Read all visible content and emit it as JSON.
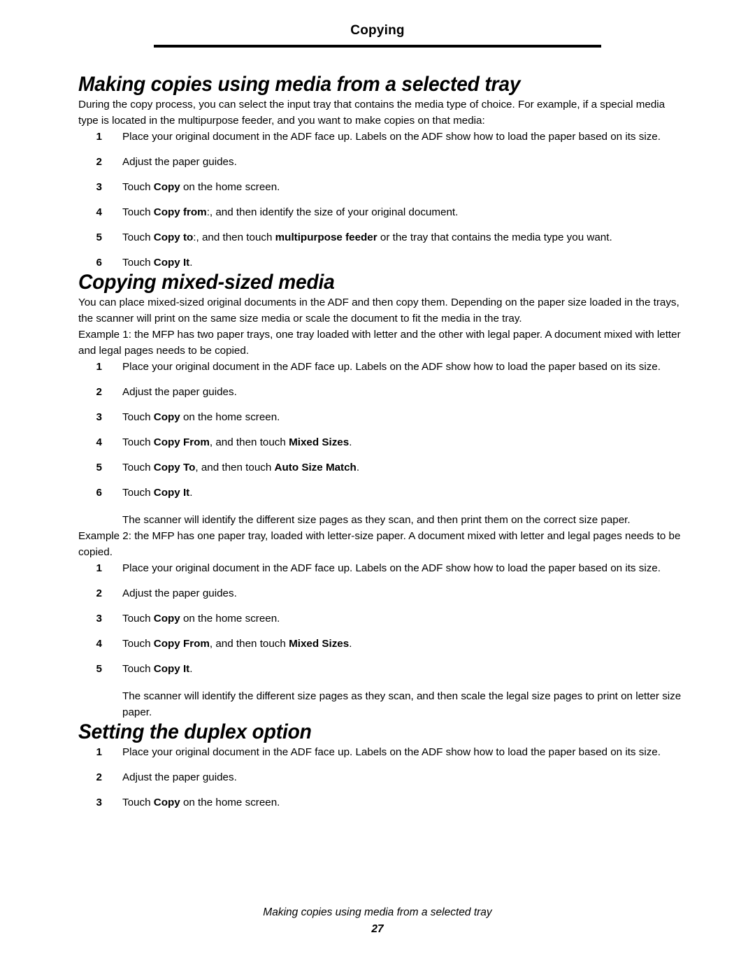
{
  "header": {
    "title": "Copying"
  },
  "sections": [
    {
      "heading": "Making copies using media from a selected tray",
      "intro": "During the copy process, you can select the input tray that contains the media type of choice. For example, if a special media type is located in the multipurpose feeder, and you want to make copies on that media:",
      "steps": [
        {
          "num": "1",
          "pre": "Place your original document in the ADF face up. Labels on the ADF show how to load the paper based on its size.",
          "b1": "",
          "mid": "",
          "b2": "",
          "post": ""
        },
        {
          "num": "2",
          "pre": "Adjust the paper guides.",
          "b1": "",
          "mid": "",
          "b2": "",
          "post": ""
        },
        {
          "num": "3",
          "pre": "Touch ",
          "b1": "Copy",
          "mid": " on the home screen.",
          "b2": "",
          "post": ""
        },
        {
          "num": "4",
          "pre": "Touch ",
          "b1": "Copy from",
          "mid": ":, and then identify the size of your original document.",
          "b2": "",
          "post": ""
        },
        {
          "num": "5",
          "pre": "Touch ",
          "b1": "Copy to",
          "mid": ":, and then touch ",
          "b2": "multipurpose feeder",
          "post": " or the tray that contains the media type you want."
        },
        {
          "num": "6",
          "pre": "Touch ",
          "b1": "Copy It",
          "mid": ".",
          "b2": "",
          "post": ""
        }
      ]
    },
    {
      "heading": "Copying mixed-sized media",
      "intro": "You can place mixed-sized original documents in the ADF and then copy them. Depending on the paper size loaded in the trays, the scanner will print on the same size media or scale the document to fit the media in the tray.",
      "example1_intro": "Example 1: the MFP has two paper trays, one tray loaded with letter and the other with legal paper. A document mixed with letter and legal pages needs to be copied.",
      "example1_steps": [
        {
          "num": "1",
          "pre": "Place your original document in the ADF face up. Labels on the ADF show how to load the paper based on its size.",
          "b1": "",
          "mid": "",
          "b2": "",
          "post": ""
        },
        {
          "num": "2",
          "pre": "Adjust the paper guides.",
          "b1": "",
          "mid": "",
          "b2": "",
          "post": ""
        },
        {
          "num": "3",
          "pre": "Touch ",
          "b1": "Copy",
          "mid": " on the home screen.",
          "b2": "",
          "post": ""
        },
        {
          "num": "4",
          "pre": "Touch ",
          "b1": "Copy From",
          "mid": ", and then touch ",
          "b2": "Mixed Sizes",
          "post": "."
        },
        {
          "num": "5",
          "pre": "Touch ",
          "b1": "Copy To",
          "mid": ", and then touch ",
          "b2": "Auto Size Match",
          "post": "."
        },
        {
          "num": "6",
          "pre": "Touch ",
          "b1": "Copy It",
          "mid": ".",
          "b2": "",
          "post": ""
        }
      ],
      "example1_note": "The scanner will identify the different size pages as they scan, and then print them on the correct size paper.",
      "example2_intro": "Example 2: the MFP has one paper tray, loaded with letter-size paper. A document mixed with letter and legal pages needs to be copied.",
      "example2_steps": [
        {
          "num": "1",
          "pre": "Place your original document in the ADF face up. Labels on the ADF show how to load the paper based on its size.",
          "b1": "",
          "mid": "",
          "b2": "",
          "post": ""
        },
        {
          "num": "2",
          "pre": "Adjust the paper guides.",
          "b1": "",
          "mid": "",
          "b2": "",
          "post": ""
        },
        {
          "num": "3",
          "pre": "Touch ",
          "b1": "Copy",
          "mid": " on the home screen.",
          "b2": "",
          "post": ""
        },
        {
          "num": "4",
          "pre": "Touch ",
          "b1": "Copy From",
          "mid": ", and then touch ",
          "b2": "Mixed Sizes",
          "post": "."
        },
        {
          "num": "5",
          "pre": "Touch ",
          "b1": "Copy It",
          "mid": ".",
          "b2": "",
          "post": ""
        }
      ],
      "example2_note": "The scanner will identify the different size pages as they scan, and then scale the legal size pages to print on letter size paper."
    },
    {
      "heading": "Setting the duplex option",
      "steps": [
        {
          "num": "1",
          "pre": "Place your original document in the ADF face up. Labels on the ADF show how to load the paper based on its size.",
          "b1": "",
          "mid": "",
          "b2": "",
          "post": ""
        },
        {
          "num": "2",
          "pre": "Adjust the paper guides.",
          "b1": "",
          "mid": "",
          "b2": "",
          "post": ""
        },
        {
          "num": "3",
          "pre": "Touch ",
          "b1": "Copy",
          "mid": " on the home screen.",
          "b2": "",
          "post": ""
        }
      ]
    }
  ],
  "footer": {
    "title": "Making copies using media from a selected tray",
    "page_number": "27"
  }
}
